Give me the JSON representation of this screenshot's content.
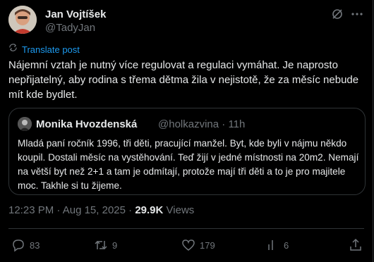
{
  "author": {
    "name": "Jan Vojtíšek",
    "handle": "@TadyJan"
  },
  "translate_label": "Translate post",
  "tweet_lines": [
    "Nájemní vztah je nutný více regulovat a regulaci vymáhat. Je naprosto",
    "nepřijatelný, aby rodina s třema dětma žila v nejistotě, že za měsíc nebude",
    "mít kde bydlet."
  ],
  "quote": {
    "name": "Monika Hvozdenská",
    "handle": "@holkazvina",
    "time": "11h",
    "lines": [
      "Mladá paní ročník 1996, tři děti, pracující manžel. Byt, kde byli v nájmu někdo",
      "koupil. Dostali měsíc na vystěhování. Teď žijí v jedné místnosti na 20m2. Nemají",
      "na větší byt než 2+1 a tam je odmítají, protože mají tři děti a to je pro majitele",
      "moc. Takhle si tu žijeme."
    ]
  },
  "meta": {
    "time": "12:23 PM",
    "date": "Aug 15, 2025",
    "views_count": "29.9K",
    "views_label": "Views"
  },
  "actions": {
    "replies": "83",
    "reposts": "9",
    "likes": "179",
    "bookmarks": "6"
  },
  "colors": {
    "background": "#000000",
    "accent": "#1d9bf0",
    "muted": "#71767b",
    "border": "#2f3336"
  }
}
